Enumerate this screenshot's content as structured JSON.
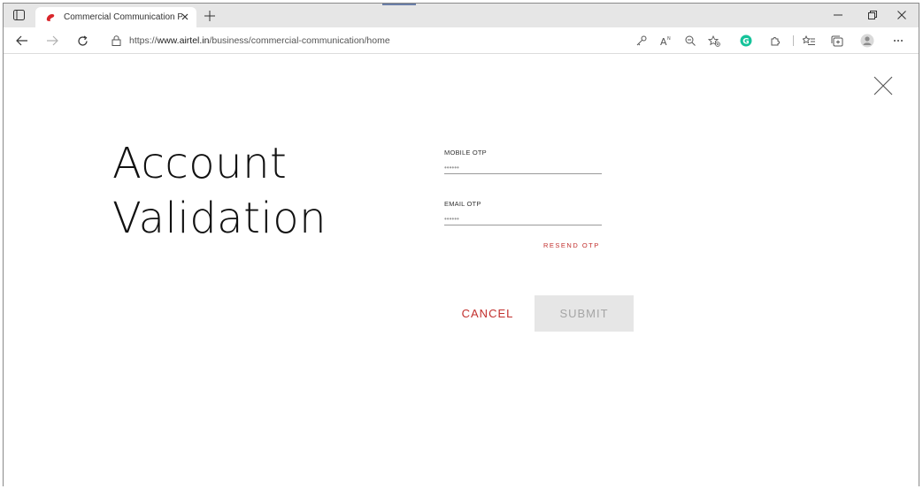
{
  "browser": {
    "tab": {
      "title": "Commercial Communication Plat",
      "favicon": "airtel-logo-icon"
    },
    "address_bar": {
      "url_prefix": "https://",
      "url_host": "www.airtel.in",
      "url_path": "/business/commercial-communication/home"
    },
    "toolbar_icons": [
      "key-icon",
      "read-aloud-icon",
      "zoom-icon",
      "add-favorite-icon",
      "grammarly-icon",
      "extensions-icon",
      "favorites-icon",
      "collections-icon",
      "profile-icon",
      "more-icon"
    ],
    "window_controls": {
      "minimize": "–",
      "maximize": "▫",
      "close": "✕"
    }
  },
  "page": {
    "heading_line1": "Account",
    "heading_line2": "Validation",
    "mobile_otp": {
      "label": "MOBILE OTP",
      "value": "••••••"
    },
    "email_otp": {
      "label": "EMAIL OTP",
      "value": "••••••"
    },
    "resend_label": "RESEND OTP",
    "cancel_label": "CANCEL",
    "submit_label": "SUBMIT"
  },
  "colors": {
    "accent_red": "#c2302e",
    "submit_disabled_bg": "#e6e6e6",
    "submit_disabled_text": "#a5a5a5"
  }
}
